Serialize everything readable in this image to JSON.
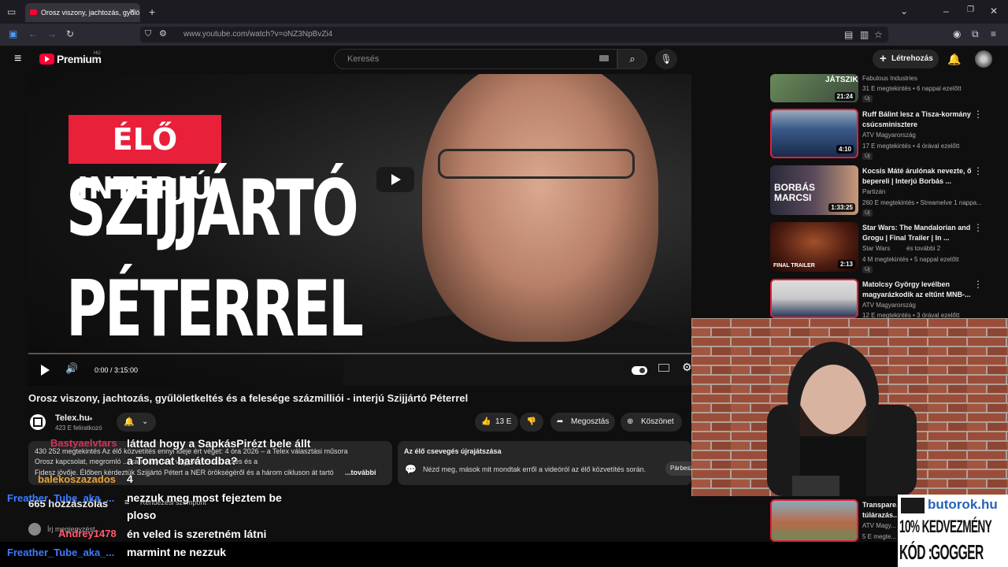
{
  "browser": {
    "tab_title": "Orosz viszony, jachtozás, gyűlöle",
    "url": "www.youtube.com/watch?v=oNZ3NpBvZi4"
  },
  "youtube": {
    "logo": "Premium",
    "region": "HU",
    "search_placeholder": "Keresés",
    "create_label": "Létrehozás"
  },
  "player": {
    "badge": "ÉLŐ INTERJÚ",
    "line1": "SZIJJÁRTÓ",
    "line2": "PÉTERREL",
    "time": "0:00 / 3:15:00"
  },
  "video": {
    "title": "Orosz viszony, jachtozás, gyűlöletkeltés és a felesége százmilliói - interjú Szijjártó Péterrel",
    "channel": "Telex.hu",
    "subscribers": "423 E feliratkozó",
    "likes": "13 E",
    "share_label": "Megosztás",
    "thanks_label": "Köszönet",
    "desc_line1": "430 252 megtekintés  Az élő közvetítés ennyi ideje ért véget: 4 óra  2026 – a Telex választási műsora",
    "desc_line2": "Orosz kapcsolat, megromló ... kampányban, vagyonvisszaszerzés és a",
    "desc_line3": "Fidesz jövője. Élőben kérdeztük Szijjártó Pétert a NER örökségéről és a három cikluson át tartó",
    "more_label": "...további",
    "live_replay_title": "Az élő csevegés újrajátszása",
    "live_replay_text": "Nézd meg, mások mit mondtak erről a videóról az élő közvetítés során.",
    "live_replay_btn": "Párbeszé",
    "comments_count": "665 hozzászólás",
    "sort_label": "Rendezési szempont",
    "comment_placeholder": "Írj megjegyzést..."
  },
  "sidebar": [
    {
      "title": "",
      "channel": "Fabulous Industries",
      "meta": "31 E megtekintés • 6 nappal ezelőtt",
      "badge": "Új",
      "duration": "21:24",
      "thumb_text": "JÁTSZIK"
    },
    {
      "title": "Ruff Bálint lesz a Tisza-kormány csúcsminisztere",
      "channel": "ATV Magyarország",
      "meta": "17 E megtekintés • 4 órával ezelőtt",
      "badge": "Új",
      "duration": "4:10",
      "thumb_text": ""
    },
    {
      "title": "Kocsis Máté árulónak nevezte, ő bepereli | Interjú Borbás ...",
      "channel": "Partizán",
      "meta": "260 E megtekintés • Streamelve 1 nappa...",
      "badge": "Új",
      "duration": "1:33:25",
      "thumb_text": "BORBÁS MARCSI"
    },
    {
      "title": "Star Wars: The Mandalorian and Grogu | Final Trailer | In ...",
      "channel": "Star Wars",
      "channel_extra": "és további 2",
      "meta": "4 M megtekintés • 5 nappal ezelőtt",
      "badge": "Új",
      "duration": "2:13",
      "thumb_text": "FINAL TRAILER"
    },
    {
      "title": "Matolcsy György levélben magyarázkodik az eltűnt MNB-...",
      "channel": "ATV Magyarország",
      "meta": "12 E megtekintés • 3 órával ezelőtt",
      "badge": "",
      "duration": "",
      "thumb_text": ""
    },
    {
      "title": "Transpare... túlárazás...",
      "channel": "ATV Magy...",
      "meta": "5 E megte...",
      "badge": "",
      "duration": "",
      "thumb_text": ""
    }
  ],
  "chat": [
    {
      "name": "Bastyaelvtars",
      "color": "#d0335a",
      "msg": "láttad hogy a SapkásPirézt bele állt"
    },
    {
      "name": "",
      "color": "#ffffff",
      "msg": "a Tomcat barátodba?"
    },
    {
      "name": "balekoszazados",
      "color": "#e8a33a",
      "msg": "4"
    },
    {
      "name": "Freather_Tube_aka_...",
      "color": "#3d7bff",
      "msg": "nezzuk meg most fejeztem be"
    },
    {
      "name": "",
      "color": "#ffffff",
      "msg": "ploso"
    },
    {
      "name": "Andrey1478",
      "color": "#ff5a6e",
      "msg": "én veled is szeretném látni"
    },
    {
      "name": "Freather_Tube_aka_...",
      "color": "#3d7bff",
      "msg": "marmint ne nezzuk"
    }
  ],
  "promo": {
    "site": "butorok.hu",
    "discount": "10% KEDVEZMÉNY",
    "code_label": "KÓD :",
    "code": "GOGGER"
  }
}
